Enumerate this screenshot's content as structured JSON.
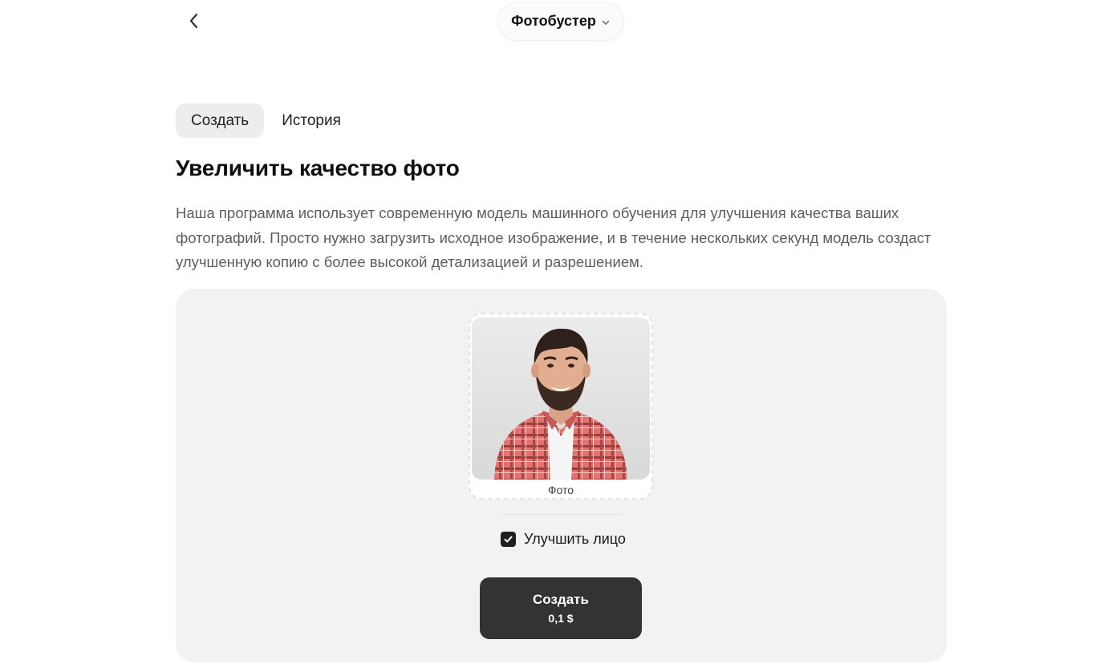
{
  "header": {
    "back_icon": "chevron-left-icon",
    "tool_select": {
      "value": "Фотобустер",
      "icon": "chevron-down-icon"
    }
  },
  "tabs": [
    {
      "label": "Создать",
      "active": true
    },
    {
      "label": "История",
      "active": false
    }
  ],
  "page": {
    "title": "Увеличить качество фото",
    "description": "Наша программа использует современную модель машинного обучения для улучшения качества ваших фотографий. Просто нужно загрузить исходное изображение, и в течение нескольких секунд модель создаст улучшенную копию с более высокой детализацией и разрешением."
  },
  "upload": {
    "caption": "Фото"
  },
  "options": {
    "enhance_face": {
      "label": "Улучшить лицо",
      "checked": true
    }
  },
  "create_button": {
    "label": "Создать",
    "price": "0,1 $"
  },
  "colors": {
    "card_background": "#f2f2f2",
    "button_background": "#333333",
    "active_tab_background": "#ededed",
    "description_text": "#5d5d5d"
  }
}
